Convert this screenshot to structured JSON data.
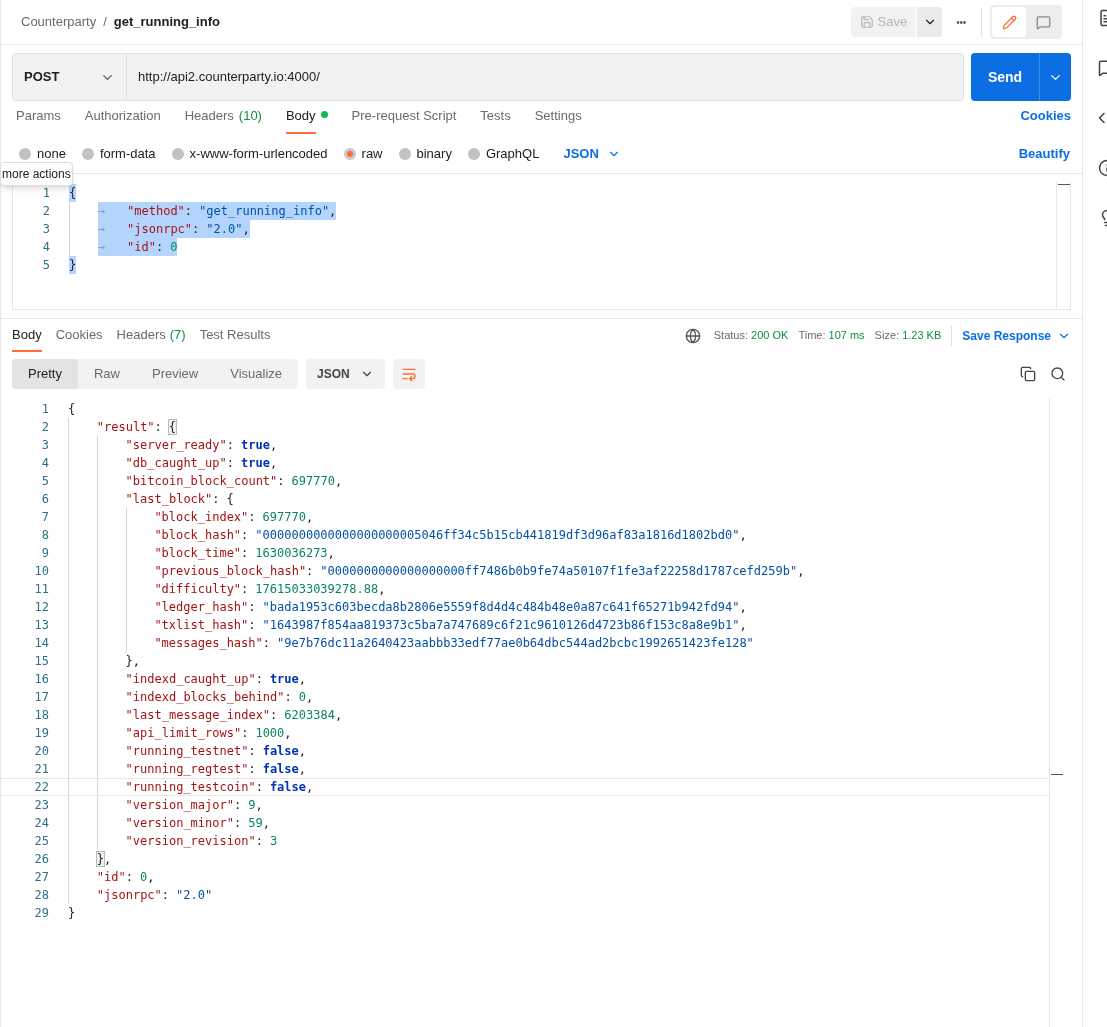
{
  "breadcrumb": {
    "collection": "Counterparty",
    "separator": "/",
    "request": "get_running_info"
  },
  "toolbar": {
    "save": "Save",
    "save_disabled": true,
    "more": "•••",
    "mode_edit_selected": true
  },
  "request": {
    "method": "POST",
    "url": "http://api2.counterparty.io:4000/",
    "send": "Send"
  },
  "request_tabs": [
    {
      "label": "Params",
      "selected": false
    },
    {
      "label": "Authorization",
      "selected": false
    },
    {
      "label": "Headers",
      "count": "(10)",
      "selected": false
    },
    {
      "label": "Body",
      "selected": true,
      "dot": true
    },
    {
      "label": "Pre-request Script",
      "selected": false
    },
    {
      "label": "Tests",
      "selected": false
    },
    {
      "label": "Settings",
      "selected": false
    }
  ],
  "cookies_link": "Cookies",
  "body_types": [
    {
      "label": "none",
      "selected": false
    },
    {
      "label": "form-data",
      "selected": false
    },
    {
      "label": "x-www-form-urlencoded",
      "selected": false
    },
    {
      "label": "raw",
      "selected": true
    },
    {
      "label": "binary",
      "selected": false
    },
    {
      "label": "GraphQL",
      "selected": false
    }
  ],
  "raw_format": "JSON",
  "beautify": "Beautify",
  "tooltip": "more actions",
  "body_editor": {
    "lines": [
      {
        "n": "1",
        "selected": true,
        "tokens": [
          {
            "kind": "p",
            "text": "{"
          }
        ],
        "children": [
          {
            "n": "2",
            "selected": true,
            "tokens": [
              {
                "kind": "tab",
                "text": "→"
              },
              {
                "kind": "key",
                "text": "\"method\""
              },
              {
                "kind": "p",
                "text": ":"
              },
              {
                "kind": "str",
                "text": "\"get_running_info\""
              },
              {
                "kind": "p",
                "text": ","
              }
            ]
          },
          {
            "n": "3",
            "selected": true,
            "tokens": [
              {
                "kind": "tab",
                "text": "→"
              },
              {
                "kind": "key",
                "text": "\"jsonrpc\""
              },
              {
                "kind": "p",
                "text": ":"
              },
              {
                "kind": "str",
                "text": "\"2.0\""
              },
              {
                "kind": "p",
                "text": ","
              }
            ]
          },
          {
            "n": "4",
            "selected": true,
            "tokens": [
              {
                "kind": "tab",
                "text": "→"
              },
              {
                "kind": "key",
                "text": "\"id\""
              },
              {
                "kind": "p",
                "text": ":"
              },
              {
                "kind": "num",
                "text": "0"
              }
            ]
          }
        ]
      },
      {
        "n": "5",
        "selected": true,
        "tokens": [
          {
            "kind": "p",
            "text": "}"
          }
        ]
      }
    ]
  },
  "response_tabs": [
    {
      "label": "Body",
      "selected": true
    },
    {
      "label": "Cookies",
      "selected": false
    },
    {
      "label": "Headers",
      "count": "(7)",
      "selected": false
    },
    {
      "label": "Test Results",
      "selected": false
    }
  ],
  "status": [
    {
      "label": "Status:",
      "value": "200 OK"
    },
    {
      "label": "Time:",
      "value": "107 ms"
    },
    {
      "label": "Size:",
      "value": "1.23 KB"
    }
  ],
  "save_response": "Save Response",
  "view_modes": [
    {
      "label": "Pretty",
      "selected": true
    },
    {
      "label": "Raw",
      "selected": false
    },
    {
      "label": "Preview",
      "selected": false
    },
    {
      "label": "Visualize",
      "selected": false
    }
  ],
  "response_format": "JSON",
  "response_editor": {
    "lines": [
      {
        "n": "1",
        "tokens": [
          {
            "kind": "p",
            "text": "{"
          }
        ],
        "children": [
          {
            "n": "2",
            "tokens": [
              {
                "kind": "key",
                "text": "\"result\""
              },
              {
                "kind": "p",
                "text": ":"
              },
              {
                "kind": "bm",
                "text": "{"
              }
            ],
            "children": [
              {
                "n": "3",
                "tokens": [
                  {
                    "kind": "key",
                    "text": "\"server_ready\""
                  },
                  {
                    "kind": "p",
                    "text": ":"
                  },
                  {
                    "kind": "bool",
                    "text": "true"
                  },
                  {
                    "kind": "p",
                    "text": ","
                  }
                ]
              },
              {
                "n": "4",
                "tokens": [
                  {
                    "kind": "key",
                    "text": "\"db_caught_up\""
                  },
                  {
                    "kind": "p",
                    "text": ":"
                  },
                  {
                    "kind": "bool",
                    "text": "true"
                  },
                  {
                    "kind": "p",
                    "text": ","
                  }
                ]
              },
              {
                "n": "5",
                "tokens": [
                  {
                    "kind": "key",
                    "text": "\"bitcoin_block_count\""
                  },
                  {
                    "kind": "p",
                    "text": ":"
                  },
                  {
                    "kind": "num",
                    "text": "697770"
                  },
                  {
                    "kind": "p",
                    "text": ","
                  }
                ]
              },
              {
                "n": "6",
                "tokens": [
                  {
                    "kind": "key",
                    "text": "\"last_block\""
                  },
                  {
                    "kind": "p",
                    "text": ":"
                  },
                  {
                    "kind": "p",
                    "text": "{"
                  }
                ],
                "children": [
                  {
                    "n": "7",
                    "tokens": [
                      {
                        "kind": "key",
                        "text": "\"block_index\""
                      },
                      {
                        "kind": "p",
                        "text": ":"
                      },
                      {
                        "kind": "num",
                        "text": "697770"
                      },
                      {
                        "kind": "p",
                        "text": ","
                      }
                    ]
                  },
                  {
                    "n": "8",
                    "tokens": [
                      {
                        "kind": "key",
                        "text": "\"block_hash\""
                      },
                      {
                        "kind": "p",
                        "text": ":"
                      },
                      {
                        "kind": "str",
                        "text": "\"0000000000000000000005046ff34c5b15cb441819df3d96af83a1816d1802bd0\""
                      },
                      {
                        "kind": "p",
                        "text": ","
                      }
                    ]
                  },
                  {
                    "n": "9",
                    "tokens": [
                      {
                        "kind": "key",
                        "text": "\"block_time\""
                      },
                      {
                        "kind": "p",
                        "text": ":"
                      },
                      {
                        "kind": "num",
                        "text": "1630036273"
                      },
                      {
                        "kind": "p",
                        "text": ","
                      }
                    ]
                  },
                  {
                    "n": "10",
                    "tokens": [
                      {
                        "kind": "key",
                        "text": "\"previous_block_hash\""
                      },
                      {
                        "kind": "p",
                        "text": ":"
                      },
                      {
                        "kind": "str",
                        "text": "\"0000000000000000000ff7486b0b9fe74a50107f1fe3af22258d1787cefd259b\""
                      },
                      {
                        "kind": "p",
                        "text": ","
                      }
                    ]
                  },
                  {
                    "n": "11",
                    "tokens": [
                      {
                        "kind": "key",
                        "text": "\"difficulty\""
                      },
                      {
                        "kind": "p",
                        "text": ":"
                      },
                      {
                        "kind": "num",
                        "text": "17615033039278.88"
                      },
                      {
                        "kind": "p",
                        "text": ","
                      }
                    ]
                  },
                  {
                    "n": "12",
                    "tokens": [
                      {
                        "kind": "key",
                        "text": "\"ledger_hash\""
                      },
                      {
                        "kind": "p",
                        "text": ":"
                      },
                      {
                        "kind": "str",
                        "text": "\"bada1953c603becda8b2806e5559f8d4d4c484b48e0a87c641f65271b942fd94\""
                      },
                      {
                        "kind": "p",
                        "text": ","
                      }
                    ]
                  },
                  {
                    "n": "13",
                    "tokens": [
                      {
                        "kind": "key",
                        "text": "\"txlist_hash\""
                      },
                      {
                        "kind": "p",
                        "text": ":"
                      },
                      {
                        "kind": "str",
                        "text": "\"1643987f854aa819373c5ba7a747689c6f21c9610126d4723b86f153c8a8e9b1\""
                      },
                      {
                        "kind": "p",
                        "text": ","
                      }
                    ]
                  },
                  {
                    "n": "14",
                    "tokens": [
                      {
                        "kind": "key",
                        "text": "\"messages_hash\""
                      },
                      {
                        "kind": "p",
                        "text": ":"
                      },
                      {
                        "kind": "str",
                        "text": "\"9e7b76dc11a2640423aabbb33edf77ae0b64dbc544ad2bcbc1992651423fe128\""
                      }
                    ]
                  }
                ]
              },
              {
                "n": "15",
                "tokens": [
                  {
                    "kind": "p",
                    "text": "},"
                  }
                ]
              },
              {
                "n": "16",
                "tokens": [
                  {
                    "kind": "key",
                    "text": "\"indexd_caught_up\""
                  },
                  {
                    "kind": "p",
                    "text": ":"
                  },
                  {
                    "kind": "bool",
                    "text": "true"
                  },
                  {
                    "kind": "p",
                    "text": ","
                  }
                ]
              },
              {
                "n": "17",
                "tokens": [
                  {
                    "kind": "key",
                    "text": "\"indexd_blocks_behind\""
                  },
                  {
                    "kind": "p",
                    "text": ":"
                  },
                  {
                    "kind": "num",
                    "text": "0"
                  },
                  {
                    "kind": "p",
                    "text": ","
                  }
                ]
              },
              {
                "n": "18",
                "tokens": [
                  {
                    "kind": "key",
                    "text": "\"last_message_index\""
                  },
                  {
                    "kind": "p",
                    "text": ":"
                  },
                  {
                    "kind": "num",
                    "text": "6203384"
                  },
                  {
                    "kind": "p",
                    "text": ","
                  }
                ]
              },
              {
                "n": "19",
                "tokens": [
                  {
                    "kind": "key",
                    "text": "\"api_limit_rows\""
                  },
                  {
                    "kind": "p",
                    "text": ":"
                  },
                  {
                    "kind": "num",
                    "text": "1000"
                  },
                  {
                    "kind": "p",
                    "text": ","
                  }
                ]
              },
              {
                "n": "20",
                "tokens": [
                  {
                    "kind": "key",
                    "text": "\"running_testnet\""
                  },
                  {
                    "kind": "p",
                    "text": ":"
                  },
                  {
                    "kind": "bool",
                    "text": "false"
                  },
                  {
                    "kind": "p",
                    "text": ","
                  }
                ]
              },
              {
                "n": "21",
                "tokens": [
                  {
                    "kind": "key",
                    "text": "\"running_regtest\""
                  },
                  {
                    "kind": "p",
                    "text": ":"
                  },
                  {
                    "kind": "bool",
                    "text": "false"
                  },
                  {
                    "kind": "p",
                    "text": ","
                  }
                ]
              },
              {
                "n": "22",
                "active": true,
                "tokens": [
                  {
                    "kind": "key",
                    "text": "\"running_testcoin\""
                  },
                  {
                    "kind": "p",
                    "text": ":"
                  },
                  {
                    "kind": "bool",
                    "text": "false"
                  },
                  {
                    "kind": "p",
                    "text": ","
                  }
                ]
              },
              {
                "n": "23",
                "tokens": [
                  {
                    "kind": "key",
                    "text": "\"version_major\""
                  },
                  {
                    "kind": "p",
                    "text": ":"
                  },
                  {
                    "kind": "num",
                    "text": "9"
                  },
                  {
                    "kind": "p",
                    "text": ","
                  }
                ]
              },
              {
                "n": "24",
                "tokens": [
                  {
                    "kind": "key",
                    "text": "\"version_minor\""
                  },
                  {
                    "kind": "p",
                    "text": ":"
                  },
                  {
                    "kind": "num",
                    "text": "59"
                  },
                  {
                    "kind": "p",
                    "text": ","
                  }
                ]
              },
              {
                "n": "25",
                "tokens": [
                  {
                    "kind": "key",
                    "text": "\"version_revision\""
                  },
                  {
                    "kind": "p",
                    "text": ":"
                  },
                  {
                    "kind": "num",
                    "text": "3"
                  }
                ]
              }
            ]
          },
          {
            "n": "26",
            "tokens": [
              {
                "kind": "bm",
                "text": "}"
              },
              {
                "kind": "p",
                "text": ","
              }
            ]
          },
          {
            "n": "27",
            "tokens": [
              {
                "kind": "key",
                "text": "\"id\""
              },
              {
                "kind": "p",
                "text": ":"
              },
              {
                "kind": "num",
                "text": "0"
              },
              {
                "kind": "p",
                "text": ","
              }
            ]
          },
          {
            "n": "28",
            "tokens": [
              {
                "kind": "key",
                "text": "\"jsonrpc\""
              },
              {
                "kind": "p",
                "text": ":"
              },
              {
                "kind": "str",
                "text": "\"2.0\""
              }
            ]
          }
        ]
      },
      {
        "n": "29",
        "tokens": [
          {
            "kind": "p",
            "text": "}"
          }
        ]
      }
    ]
  }
}
